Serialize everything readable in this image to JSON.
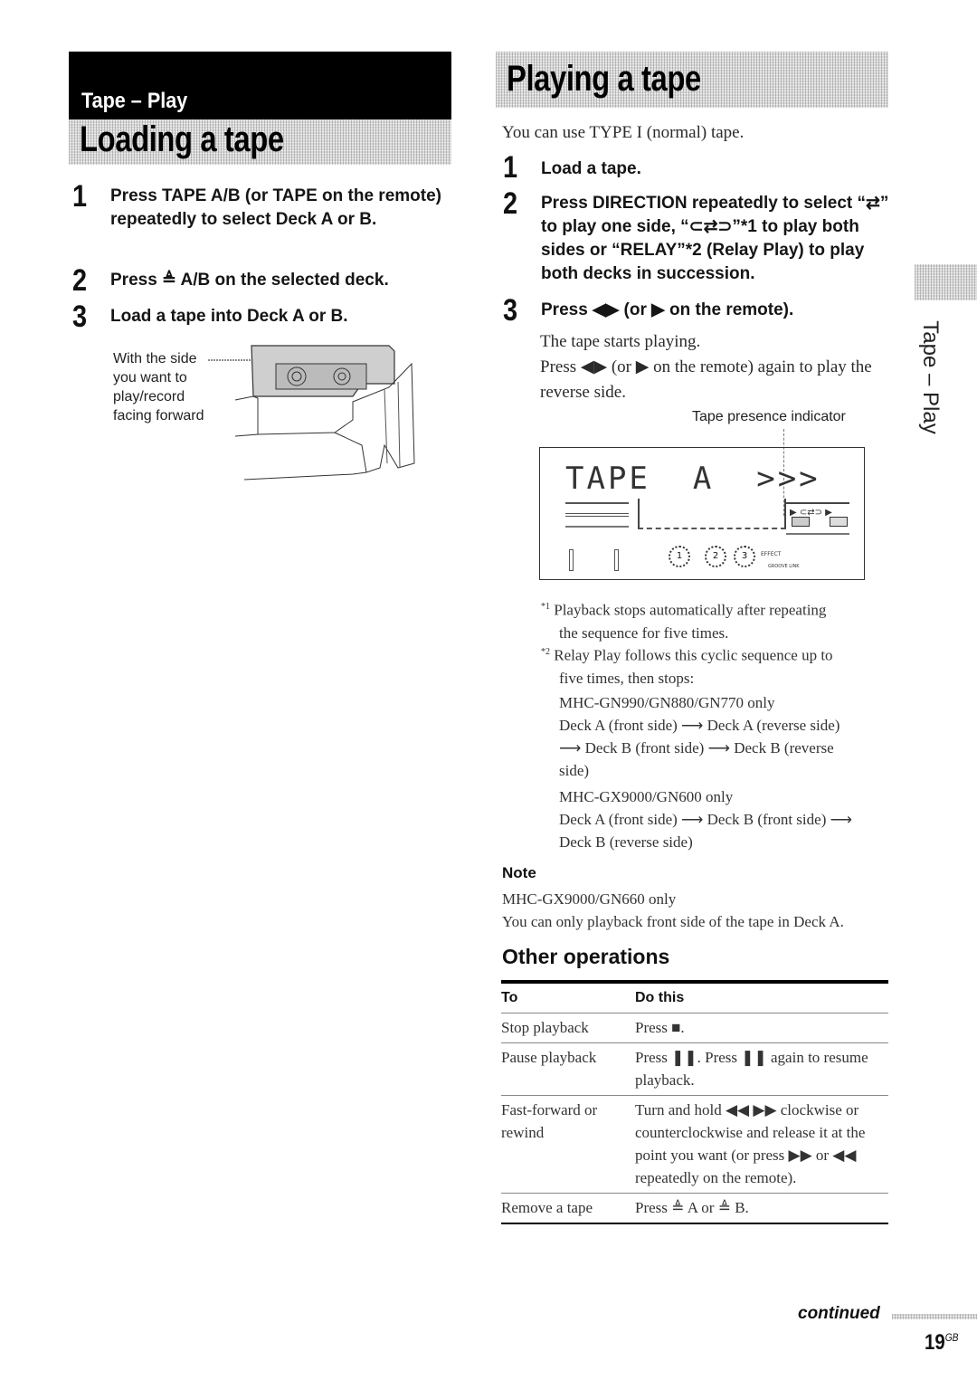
{
  "section_category": "Tape – Play",
  "loading": {
    "title": "Loading a tape",
    "steps": [
      {
        "num": "1",
        "text": "Press TAPE A/B (or TAPE on the remote) repeatedly to select Deck A or B."
      },
      {
        "num": "2",
        "text": "Press ≜ A/B on the selected deck."
      },
      {
        "num": "3",
        "text": "Load a tape into Deck A or B."
      }
    ],
    "illustration_caption": "With the side you want to play/record facing forward"
  },
  "playing": {
    "title": "Playing a tape",
    "intro": "You can use TYPE I (normal) tape.",
    "steps": [
      {
        "num": "1",
        "text": "Load a tape."
      },
      {
        "num": "2",
        "text": "Press DIRECTION repeatedly to select “⇄” to play one side, “⊂⇄⊃”*1 to play both sides or “RELAY”*2 (Relay Play) to play both decks in succession."
      },
      {
        "num": "3",
        "text": "Press ◀▶ (or ▶ on the remote)."
      }
    ],
    "step3_body": [
      "The tape starts playing.",
      "Press ◀▶ (or ▶ on the remote) again to play the reverse side."
    ],
    "display_callout": "Tape presence indicator",
    "display": {
      "main_text": "TAPE  A  >>>",
      "effect_label": "EFFECT",
      "groove_label": "GROOVE LINK",
      "knob_labels": [
        "1",
        "2",
        "3"
      ]
    },
    "footnotes": [
      {
        "mark": "*1",
        "lines": [
          "Playback stops automatically after repeating",
          "the sequence for five times."
        ]
      },
      {
        "mark": "*2",
        "lines": [
          "Relay Play follows this cyclic sequence up to",
          "five times, then stops:"
        ]
      }
    ],
    "relay_sequences": [
      {
        "model": "MHC-GN990/GN880/GN770 only",
        "lines": [
          "Deck A (front side) ⟶ Deck A (reverse side)",
          "⟶ Deck B (front side) ⟶ Deck B (reverse",
          "side)"
        ]
      },
      {
        "model": "MHC-GX9000/GN600 only",
        "lines": [
          "Deck A (front side) ⟶ Deck B (front side) ⟶",
          "Deck B (reverse side)"
        ]
      }
    ],
    "note": {
      "heading": "Note",
      "lines": [
        "MHC-GX9000/GN660 only",
        "You can only playback front side of the tape in Deck A."
      ]
    }
  },
  "other_operations": {
    "title": "Other operations",
    "columns": [
      "To",
      "Do this"
    ],
    "rows": [
      {
        "to": "Stop playback",
        "do": "Press ■."
      },
      {
        "to": "Pause playback",
        "do": "Press ❚❚. Press ❚❚ again to resume playback."
      },
      {
        "to": "Fast-forward or rewind",
        "do": "Turn and hold ◀◀ ▶▶ clockwise or counterclockwise and release it at the point you want (or press ▶▶ or ◀◀ repeatedly on the remote)."
      },
      {
        "to": "Remove a tape",
        "do": "Press ≜ A or ≜ B."
      }
    ]
  },
  "side_tab_label": "Tape – Play",
  "footer": {
    "continued": "continued",
    "page_number": "19",
    "page_suffix": "GB"
  }
}
